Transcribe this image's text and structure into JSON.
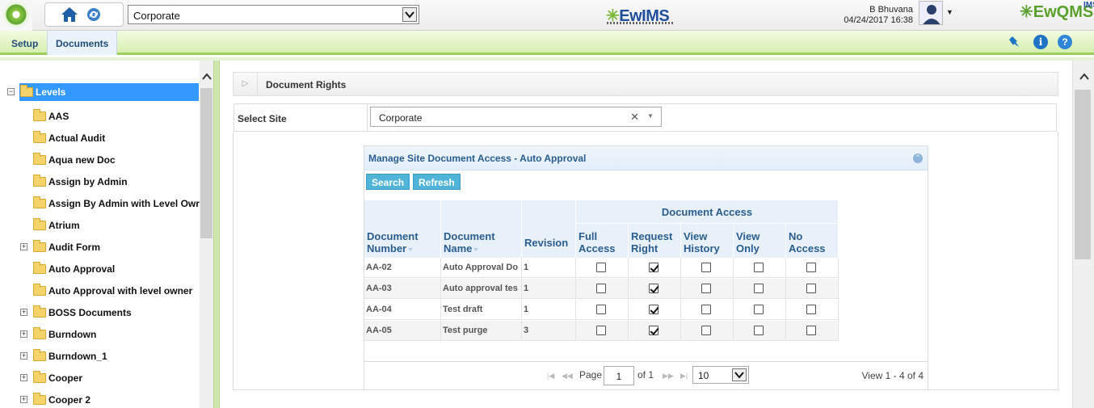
{
  "header": {
    "site_selected": "Corporate",
    "brand": "EwIMS",
    "user_name": "B Bhuvana",
    "datetime": "04/24/2017 16:38",
    "brand_right": "EwQMS",
    "brand_right_small": "IMS"
  },
  "menu": {
    "setup": "Setup",
    "documents": "Documents"
  },
  "tree": {
    "root": "Levels",
    "items": [
      {
        "label": "AAS",
        "expandable": false
      },
      {
        "label": "Actual Audit",
        "expandable": false
      },
      {
        "label": "Aqua new Doc",
        "expandable": false
      },
      {
        "label": "Assign by Admin",
        "expandable": false
      },
      {
        "label": "Assign By Admin with Level Owr",
        "expandable": false
      },
      {
        "label": "Atrium",
        "expandable": false
      },
      {
        "label": "Audit Form",
        "expandable": true
      },
      {
        "label": "Auto Approval",
        "expandable": false
      },
      {
        "label": "Auto Approval with level owner",
        "expandable": false
      },
      {
        "label": "BOSS Documents",
        "expandable": true
      },
      {
        "label": "Burndown",
        "expandable": true
      },
      {
        "label": "Burndown_1",
        "expandable": true
      },
      {
        "label": "Cooper",
        "expandable": true
      },
      {
        "label": "Cooper 2",
        "expandable": true
      }
    ]
  },
  "panel": {
    "title": "Document Rights",
    "site_label": "Select Site",
    "site_value": "Corporate"
  },
  "grid": {
    "caption": "Manage Site Document Access - Auto Approval",
    "search_label": "Search",
    "refresh_label": "Refresh",
    "group_header": "Document Access",
    "columns": {
      "doc_number": "Document Number",
      "doc_name": "Document Name",
      "revision": "Revision",
      "full_access": "Full Access",
      "request_right": "Request Right",
      "view_history": "View History",
      "view_only": "View Only",
      "no_access": "No Access"
    },
    "rows": [
      {
        "number": "AA-02",
        "name": "Auto Approval Do",
        "revision": "1",
        "access": [
          false,
          true,
          false,
          false,
          false
        ]
      },
      {
        "number": "AA-03",
        "name": "Auto approval tes",
        "revision": "1",
        "access": [
          false,
          true,
          false,
          false,
          false
        ]
      },
      {
        "number": "AA-04",
        "name": "Test draft",
        "revision": "1",
        "access": [
          false,
          true,
          false,
          false,
          false
        ]
      },
      {
        "number": "AA-05",
        "name": "Test purge",
        "revision": "3",
        "access": [
          false,
          true,
          false,
          false,
          false
        ]
      }
    ],
    "pager": {
      "page_label": "Page",
      "page_value": "1",
      "of_label": "of 1",
      "rows_per_page": "10",
      "view_records": "View 1 - 4 of 4"
    }
  }
}
